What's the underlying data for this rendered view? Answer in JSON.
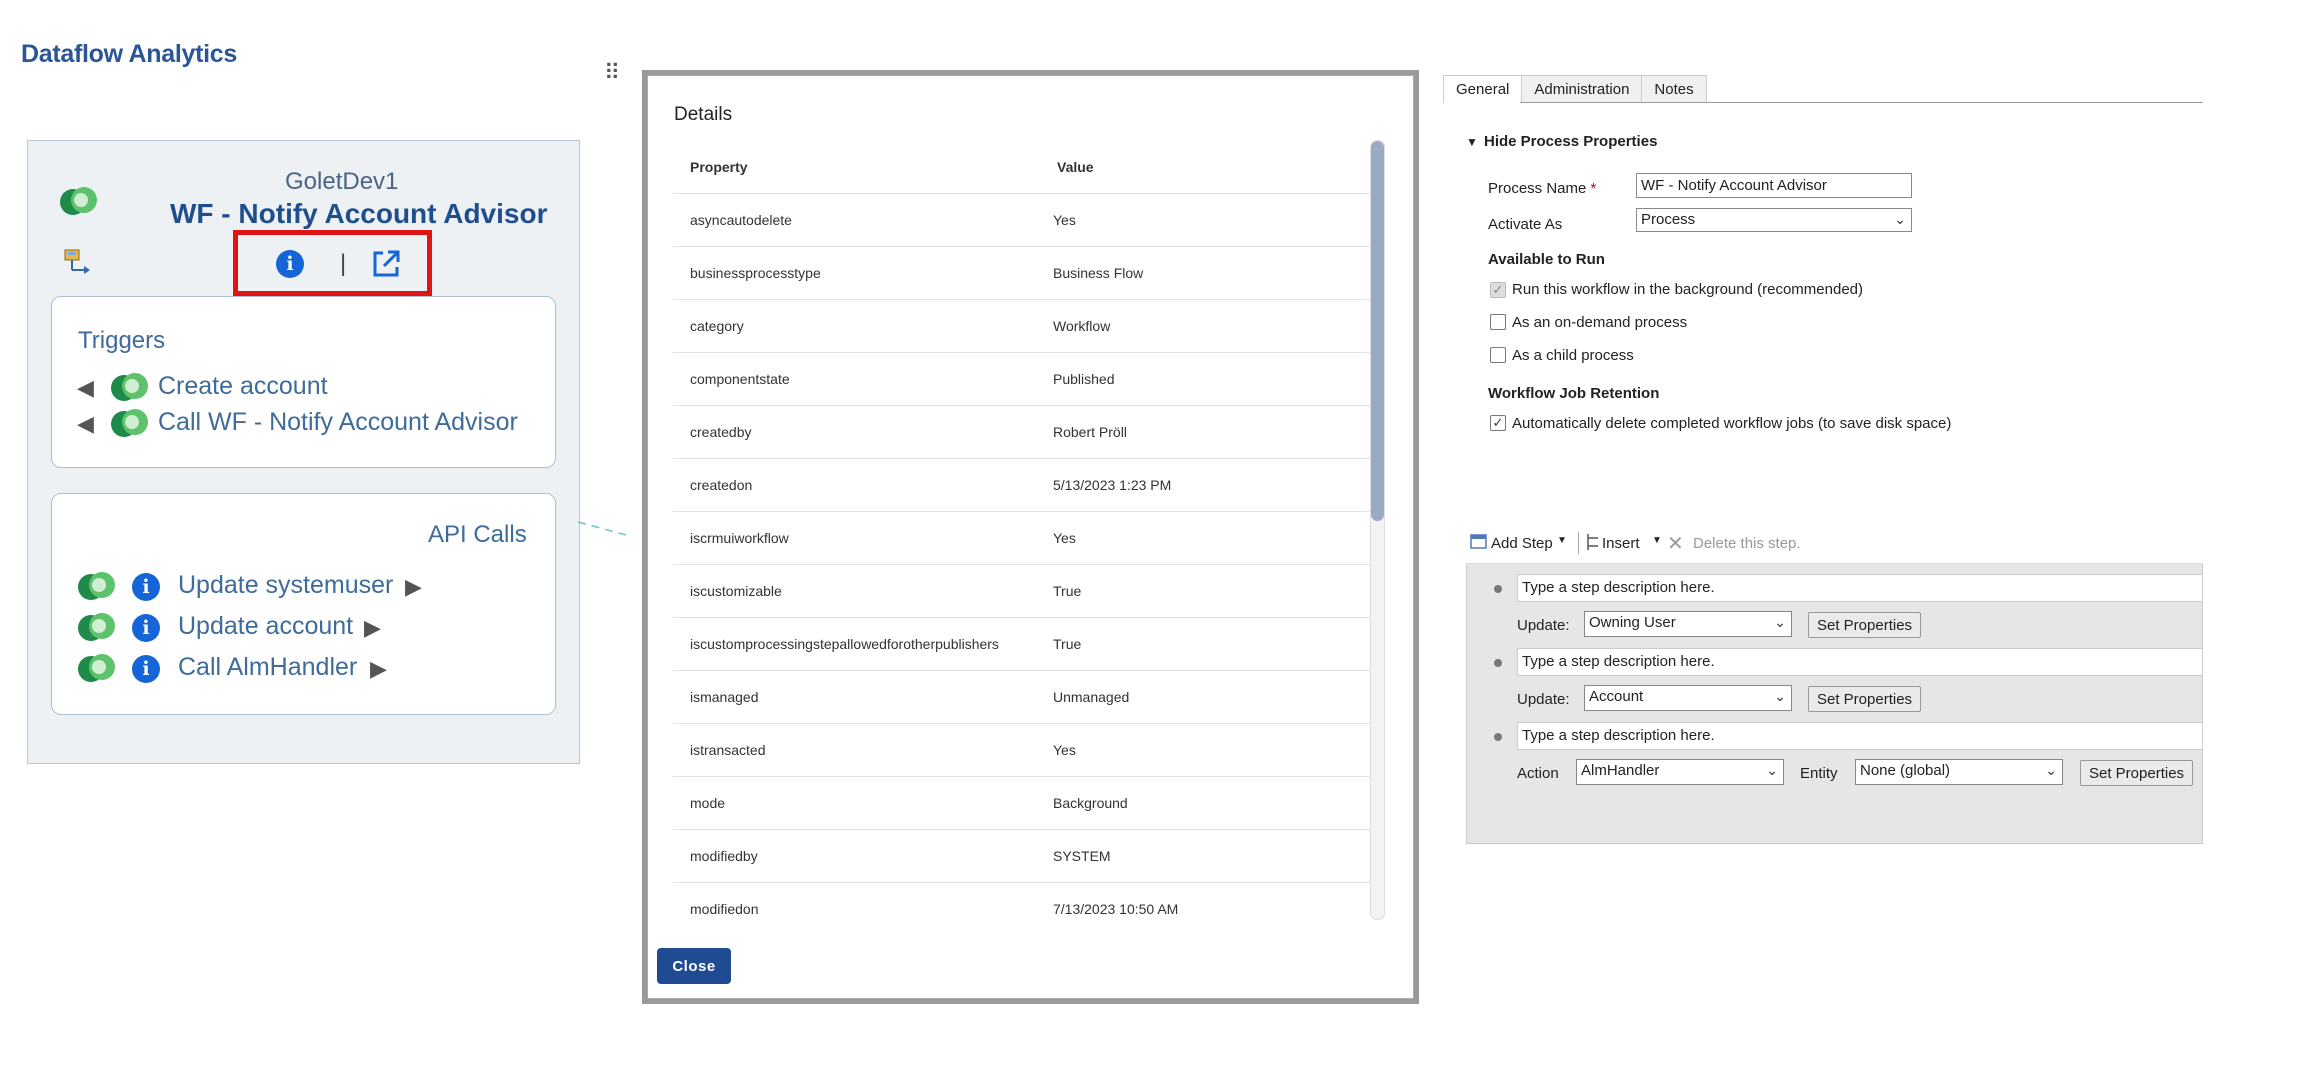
{
  "app": {
    "title": "Dataflow Analytics"
  },
  "node": {
    "environment": "GoletDev1",
    "title": "WF - Notify Account Advisor",
    "separator": "|"
  },
  "triggers": {
    "title": "Triggers",
    "items": [
      {
        "label": "Create account"
      },
      {
        "label": "Call WF - Notify Account Advisor"
      }
    ]
  },
  "api_calls": {
    "title": "API Calls",
    "items": [
      {
        "label": "Update systemuser"
      },
      {
        "label": "Update account"
      },
      {
        "label": "Call AlmHandler"
      }
    ]
  },
  "details": {
    "title": "Details",
    "columns": [
      "Property",
      "Value"
    ],
    "rows": [
      [
        "asyncautodelete",
        "Yes"
      ],
      [
        "businessprocesstype",
        "Business Flow"
      ],
      [
        "category",
        "Workflow"
      ],
      [
        "componentstate",
        "Published"
      ],
      [
        "createdby",
        "Robert Pröll"
      ],
      [
        "createdon",
        "5/13/2023 1:23 PM"
      ],
      [
        "iscrmuiworkflow",
        "Yes"
      ],
      [
        "iscustomizable",
        "True"
      ],
      [
        "iscustomprocessingstepallowedforotherpublishers",
        "True"
      ],
      [
        "ismanaged",
        "Unmanaged"
      ],
      [
        "istransacted",
        "Yes"
      ],
      [
        "mode",
        "Background"
      ],
      [
        "modifiedby",
        "SYSTEM"
      ],
      [
        "modifiedon",
        "7/13/2023 10:50 AM"
      ]
    ],
    "close_label": "Close"
  },
  "form": {
    "tabs": [
      "General",
      "Administration",
      "Notes"
    ],
    "active_tab": "General",
    "section_title": "Hide Process Properties",
    "process_name_label": "Process Name",
    "process_name_value": "WF - Notify Account Advisor",
    "activate_as_label": "Activate As",
    "activate_as_value": "Process",
    "available_to_run_title": "Available to Run",
    "options": [
      {
        "label": "Run this workflow in the background (recommended)",
        "checked": true,
        "disabled": true
      },
      {
        "label": "As an on-demand process",
        "checked": false,
        "disabled": false
      },
      {
        "label": "As a child process",
        "checked": false,
        "disabled": false
      }
    ],
    "retention_title": "Workflow Job Retention",
    "retention_option": {
      "label": "Automatically delete completed workflow jobs (to save disk space)",
      "checked": true
    }
  },
  "steps": {
    "toolbar": {
      "add_step": "Add Step",
      "insert": "Insert",
      "delete": "Delete this step."
    },
    "items": [
      {
        "description": "Type a step description here.",
        "kind_label": "Update:",
        "selected": "Owning User",
        "button": "Set Properties"
      },
      {
        "description": "Type a step description here.",
        "kind_label": "Update:",
        "selected": "Account",
        "button": "Set Properties"
      },
      {
        "description": "Type a step description here.",
        "kind_label": "Action",
        "selected": "AlmHandler",
        "entity_label": "Entity",
        "entity_selected": "None (global)",
        "button": "Set Properties"
      }
    ]
  }
}
